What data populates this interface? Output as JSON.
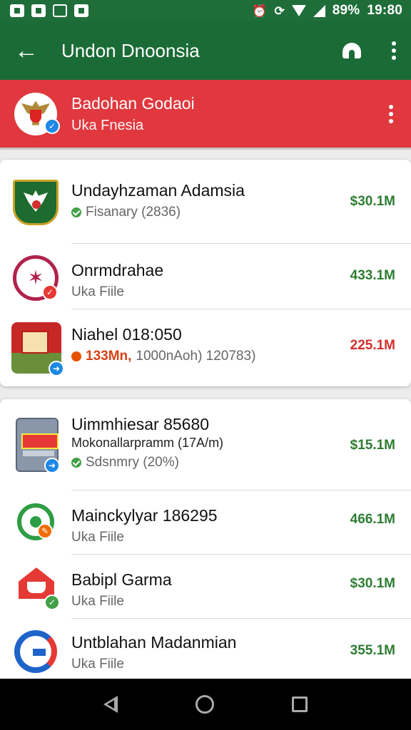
{
  "status_bar": {
    "battery": "89%",
    "time": "19:80"
  },
  "app_bar": {
    "title": "Undon Dnoonsia"
  },
  "banner": {
    "title": "Badohan Godaoi",
    "subtitle": "Uka Fnesia"
  },
  "card1": {
    "rows": [
      {
        "title": "Undayhzaman Adamsia",
        "subtitle": "Fisanary (2836)",
        "amount": "$30.1M",
        "amount_color": "#2e7d32"
      },
      {
        "title": "Onrmdrahae",
        "subtitle": "Uka Fiile",
        "amount": "433.1M",
        "amount_color": "#2e7d32"
      },
      {
        "title": "Niahel 018:050",
        "subtitle_warn": "133Mn,",
        "subtitle": "1000nAoh) 120783)",
        "amount": "225.1M",
        "amount_color": "#d32f2f"
      }
    ]
  },
  "card2": {
    "rows": [
      {
        "title": "Uimmhiesar 85680",
        "extra": "Mokonallarpramm (17A/m)",
        "subtitle": "Sdsnmry (20%)",
        "amount": "$15.1M",
        "amount_color": "#2e7d32"
      },
      {
        "title": "Mainckylyar 186295",
        "subtitle": "Uka Fiile",
        "amount": "466.1M",
        "amount_color": "#2e7d32"
      },
      {
        "title": "Babipl Garma",
        "subtitle": "Uka Fiile",
        "amount": "$30.1M",
        "amount_color": "#2e7d32"
      },
      {
        "title": "Untblahan Madanmian",
        "subtitle": "Uka Fiile",
        "amount": "355.1M",
        "amount_color": "#2e7d32"
      }
    ]
  },
  "icons": {
    "row1": "garuda-crest-icon",
    "row2": "star-ring-icon",
    "row3": "photo-thumbnail-icon",
    "row4": "document-icon",
    "row5": "green-g-icon",
    "row6": "red-house-icon",
    "row7": "c-logo-icon"
  }
}
